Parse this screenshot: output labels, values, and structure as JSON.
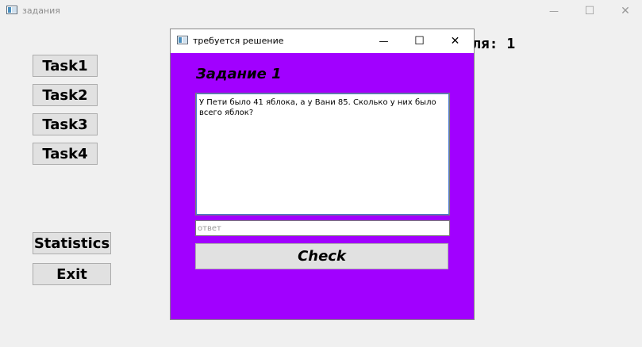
{
  "window": {
    "title": "задания",
    "controls": {
      "minimize": "—",
      "maximize": "☐",
      "close": "✕"
    }
  },
  "sidebar": {
    "task_buttons": [
      {
        "label": "Task1"
      },
      {
        "label": "Task2"
      },
      {
        "label": "Task3"
      },
      {
        "label": "Task4"
      }
    ],
    "statistics_label": "Statistics",
    "exit_label": "Exit"
  },
  "score": {
    "visible_text": "ля:",
    "value": "1"
  },
  "dialog": {
    "title": "требуется решение",
    "controls": {
      "minimize": "—",
      "maximize": "☐",
      "close": "✕"
    },
    "background_color": "#a100ff",
    "heading": "Задание 1",
    "question": "У Пети было 41 яблока, а у Вани 85. Сколько у них было всего яблок?",
    "answer_placeholder": "ответ",
    "answer_value": "",
    "check_label": "Check"
  }
}
